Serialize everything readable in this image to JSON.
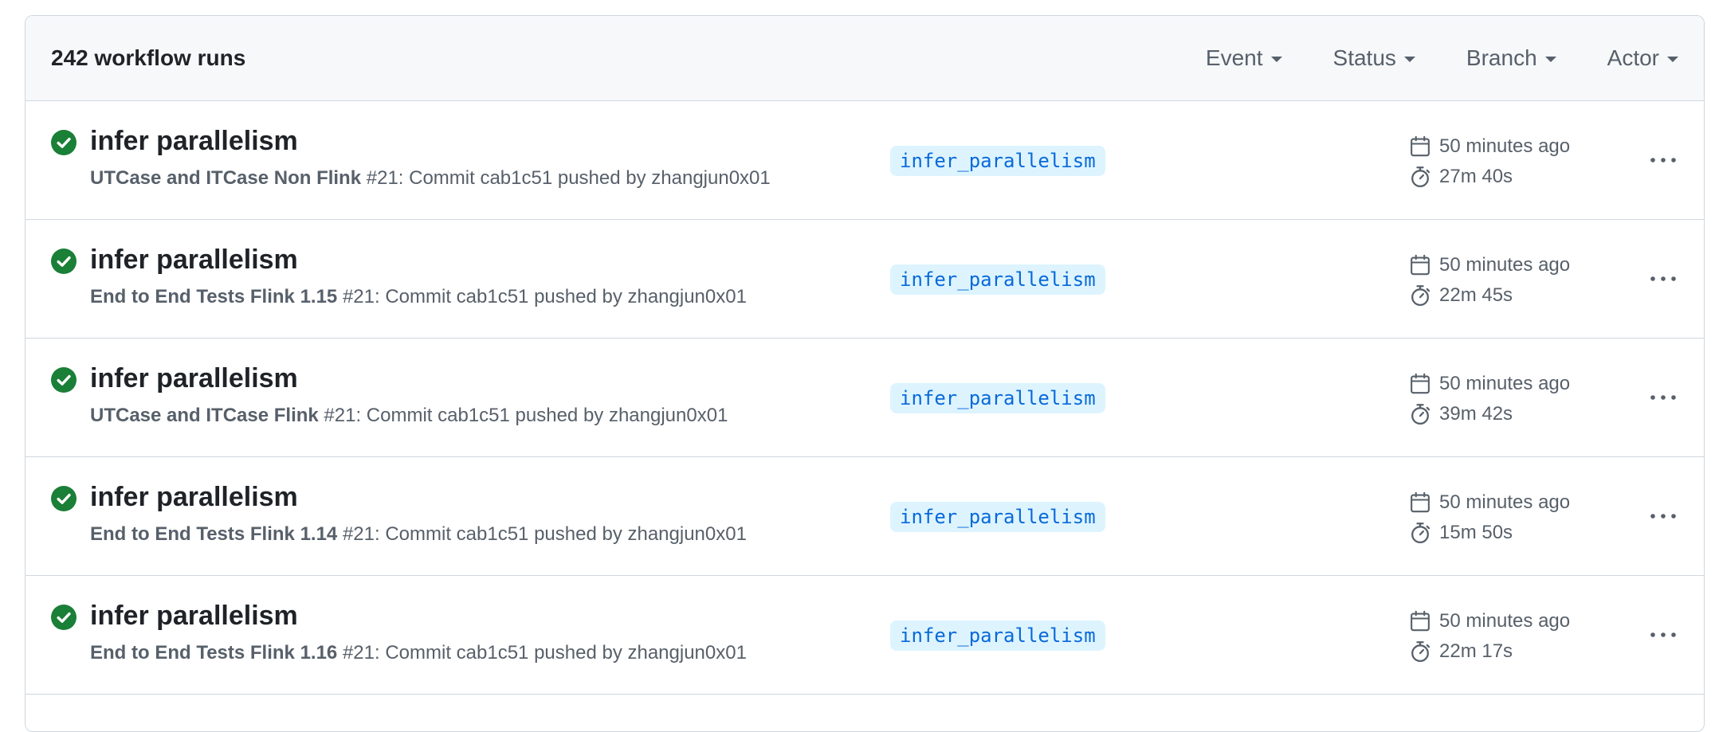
{
  "header": {
    "runs_count": "242 workflow runs",
    "filters": [
      {
        "label": "Event"
      },
      {
        "label": "Status"
      },
      {
        "label": "Branch"
      },
      {
        "label": "Actor"
      }
    ]
  },
  "runs": [
    {
      "status": "success",
      "title": "infer parallelism",
      "workflow": "UTCase and ITCase Non Flink",
      "detail": " #21: Commit cab1c51 pushed by zhangjun0x01",
      "branch": "infer_parallelism",
      "time_ago": "50 minutes ago",
      "duration": "27m 40s"
    },
    {
      "status": "success",
      "title": "infer parallelism",
      "workflow": "End to End Tests Flink 1.15",
      "detail": " #21: Commit cab1c51 pushed by zhangjun0x01",
      "branch": "infer_parallelism",
      "time_ago": "50 minutes ago",
      "duration": "22m 45s"
    },
    {
      "status": "success",
      "title": "infer parallelism",
      "workflow": "UTCase and ITCase Flink",
      "detail": " #21: Commit cab1c51 pushed by zhangjun0x01",
      "branch": "infer_parallelism",
      "time_ago": "50 minutes ago",
      "duration": "39m 42s"
    },
    {
      "status": "success",
      "title": "infer parallelism",
      "workflow": "End to End Tests Flink 1.14",
      "detail": " #21: Commit cab1c51 pushed by zhangjun0x01",
      "branch": "infer_parallelism",
      "time_ago": "50 minutes ago",
      "duration": "15m 50s"
    },
    {
      "status": "success",
      "title": "infer parallelism",
      "workflow": "End to End Tests Flink 1.16",
      "detail": " #21: Commit cab1c51 pushed by zhangjun0x01",
      "branch": "infer_parallelism",
      "time_ago": "50 minutes ago",
      "duration": "22m 17s"
    }
  ],
  "colors": {
    "success": "#1a7f37",
    "branch_bg": "#ddf4ff",
    "branch_fg": "#0969da",
    "muted": "#57606a"
  },
  "icons": {
    "status": "check-circle-fill-icon",
    "time": "calendar-icon",
    "duration": "stopwatch-icon",
    "more": "kebab-horizontal-icon",
    "filter": "triangle-down-icon"
  }
}
